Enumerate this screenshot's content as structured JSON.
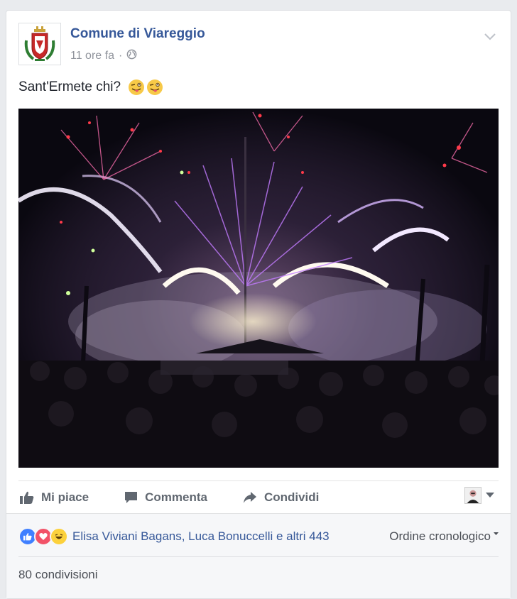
{
  "post": {
    "page_name": "Comune di Viareggio",
    "time": "11 ore fa",
    "separator": "·",
    "privacy_icon": "globe-icon",
    "text": "Sant'Ermete chi?",
    "emoji": [
      "winking-tongue-emoji",
      "winking-tongue-emoji"
    ]
  },
  "actions": {
    "like_label": "Mi piace",
    "comment_label": "Commenta",
    "share_label": "Condividi"
  },
  "reactions": {
    "icons": [
      "like-reaction-icon",
      "love-reaction-icon",
      "haha-reaction-icon"
    ],
    "names": "Elisa Viviani Bagans, Luca Bonuccelli e altri 443",
    "order_label": "Ordine cronologico",
    "shares": "80 condivisioni"
  },
  "colors": {
    "link_blue": "#365899",
    "like_blue": "#4080ff",
    "love_red": "#f25268",
    "haha_yellow": "#fcd13c",
    "muted": "#90949c"
  }
}
